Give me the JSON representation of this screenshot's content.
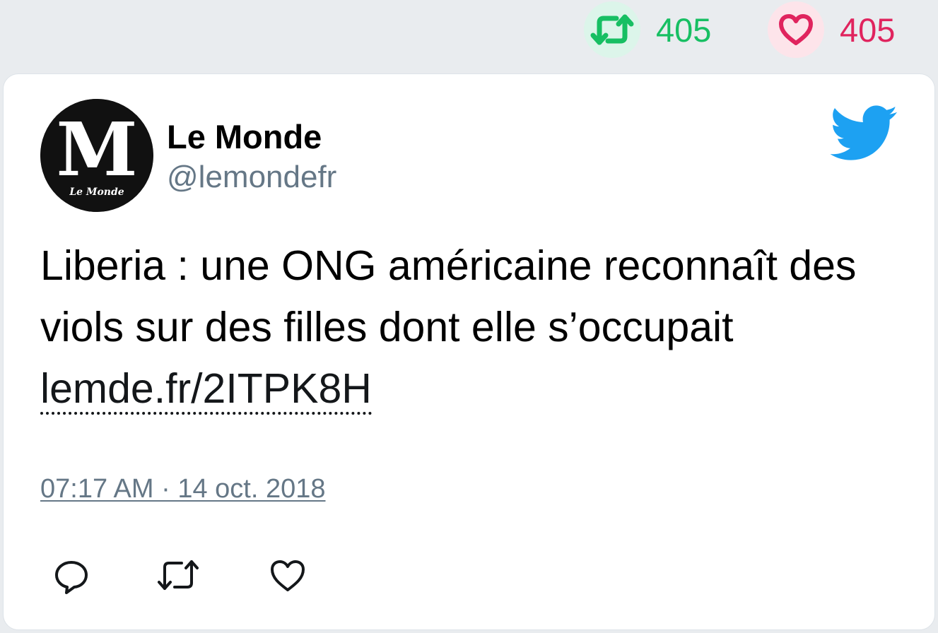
{
  "stats": {
    "retweets": "405",
    "likes": "405"
  },
  "tweet": {
    "author_name": "Le Monde",
    "author_handle": "@lemondefr",
    "text_before_link": "Liberia : une ONG américaine reconnaît des viols sur des filles dont elle s’occupait ",
    "link_text": "lemde.fr/2ITPK8H",
    "timestamp": "07:17 AM · 14 oct. 2018"
  },
  "avatar": {
    "logo_letter": "M",
    "logo_caption": "Le Monde"
  },
  "colors": {
    "retweet": "#17bf63",
    "like": "#e0245e",
    "twitter_blue": "#1da1f2",
    "secondary_text": "#657786"
  },
  "icons": {
    "stat_retweet": "retweet-icon",
    "stat_like": "heart-icon",
    "brand": "twitter-bird-icon",
    "reply": "reply-icon",
    "retweet": "retweet-icon",
    "like": "heart-icon"
  }
}
